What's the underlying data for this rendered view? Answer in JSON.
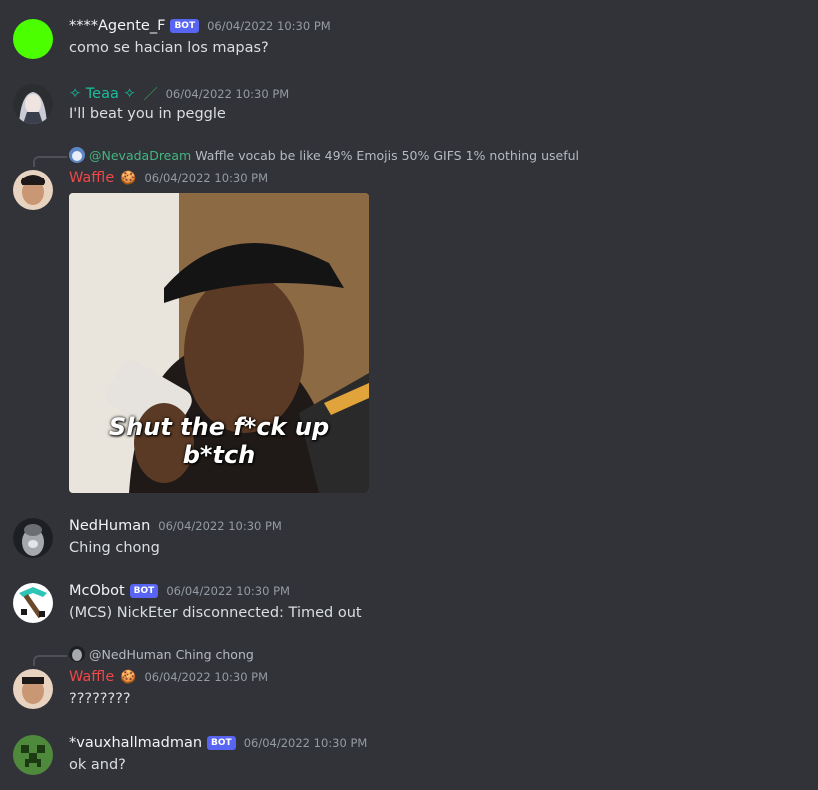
{
  "messages": [
    {
      "username": "****Agente_F",
      "bot_badge": "BOT",
      "timestamp": "06/04/2022 10:30 PM",
      "text": "como se hacian los mapas?",
      "avatar": "green-circle-avatar",
      "name_color": "#f2f3f5"
    },
    {
      "username": "✧ Teaa ✧",
      "role_icon": "／",
      "timestamp": "06/04/2022 10:30 PM",
      "text": "I'll beat you in peggle",
      "avatar": "anime-girl-avatar",
      "name_color": "#1abc9c"
    },
    {
      "reply": {
        "name": "@NevadaDream",
        "text": "Waffle vocab be like 49% Emojis 50% GIFS 1% nothing useful",
        "name_color": "#43b581"
      },
      "username": "Waffle",
      "emoji": "🍪",
      "timestamp": "06/04/2022 10:30 PM",
      "avatar": "person-avatar",
      "name_color": "#f04747",
      "gif_caption": "Shut the f*ck up b*tch"
    },
    {
      "username": "NedHuman",
      "timestamp": "06/04/2022 10:30 PM",
      "text": "Ching chong",
      "avatar": "grey-creature-avatar",
      "name_color": "#f2f3f5"
    },
    {
      "username": "McObot",
      "bot_badge": "BOT",
      "timestamp": "06/04/2022 10:30 PM",
      "text": "(MCS) NickEter disconnected: Timed out",
      "avatar": "pickaxe-avatar",
      "name_color": "#f2f3f5"
    },
    {
      "reply": {
        "name": "@NedHuman",
        "text": "Ching chong",
        "name_color": "#b5bac1"
      },
      "username": "Waffle",
      "emoji": "🍪",
      "timestamp": "06/04/2022 10:30 PM",
      "text": "????????",
      "avatar": "person-avatar",
      "name_color": "#f04747"
    },
    {
      "username": "*vauxhallmadman",
      "bot_badge": "BOT",
      "timestamp": "06/04/2022 10:30 PM",
      "text": "ok and?",
      "avatar": "pixel-creeper-avatar",
      "name_color": "#f2f3f5"
    }
  ],
  "colors": {
    "background": "#313338",
    "bot_badge": "#5865f2",
    "timestamp": "#949ba4"
  }
}
